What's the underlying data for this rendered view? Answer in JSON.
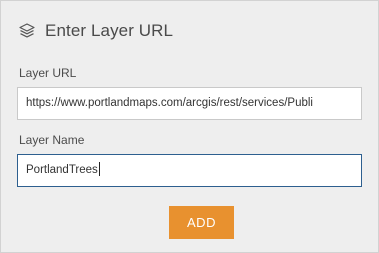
{
  "header": {
    "icon": "layers-icon",
    "title": "Enter Layer URL"
  },
  "form": {
    "layer_url": {
      "label": "Layer URL",
      "value": "https://www.portlandmaps.com/arcgis/rest/services/Publi"
    },
    "layer_name": {
      "label": "Layer Name",
      "value": "PortlandTrees"
    },
    "add_label": "ADD"
  },
  "colors": {
    "panel_bg": "#eeeeee",
    "accent": "#e8912f",
    "focus_border": "#2d5f8f"
  }
}
